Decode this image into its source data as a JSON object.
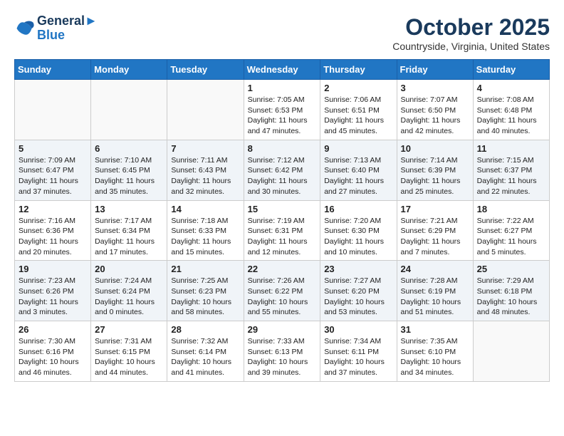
{
  "header": {
    "logo_line1": "General",
    "logo_line2": "Blue",
    "month": "October 2025",
    "location": "Countryside, Virginia, United States"
  },
  "weekdays": [
    "Sunday",
    "Monday",
    "Tuesday",
    "Wednesday",
    "Thursday",
    "Friday",
    "Saturday"
  ],
  "weeks": [
    [
      {
        "day": "",
        "info": ""
      },
      {
        "day": "",
        "info": ""
      },
      {
        "day": "",
        "info": ""
      },
      {
        "day": "1",
        "info": "Sunrise: 7:05 AM\nSunset: 6:53 PM\nDaylight: 11 hours and 47 minutes."
      },
      {
        "day": "2",
        "info": "Sunrise: 7:06 AM\nSunset: 6:51 PM\nDaylight: 11 hours and 45 minutes."
      },
      {
        "day": "3",
        "info": "Sunrise: 7:07 AM\nSunset: 6:50 PM\nDaylight: 11 hours and 42 minutes."
      },
      {
        "day": "4",
        "info": "Sunrise: 7:08 AM\nSunset: 6:48 PM\nDaylight: 11 hours and 40 minutes."
      }
    ],
    [
      {
        "day": "5",
        "info": "Sunrise: 7:09 AM\nSunset: 6:47 PM\nDaylight: 11 hours and 37 minutes."
      },
      {
        "day": "6",
        "info": "Sunrise: 7:10 AM\nSunset: 6:45 PM\nDaylight: 11 hours and 35 minutes."
      },
      {
        "day": "7",
        "info": "Sunrise: 7:11 AM\nSunset: 6:43 PM\nDaylight: 11 hours and 32 minutes."
      },
      {
        "day": "8",
        "info": "Sunrise: 7:12 AM\nSunset: 6:42 PM\nDaylight: 11 hours and 30 minutes."
      },
      {
        "day": "9",
        "info": "Sunrise: 7:13 AM\nSunset: 6:40 PM\nDaylight: 11 hours and 27 minutes."
      },
      {
        "day": "10",
        "info": "Sunrise: 7:14 AM\nSunset: 6:39 PM\nDaylight: 11 hours and 25 minutes."
      },
      {
        "day": "11",
        "info": "Sunrise: 7:15 AM\nSunset: 6:37 PM\nDaylight: 11 hours and 22 minutes."
      }
    ],
    [
      {
        "day": "12",
        "info": "Sunrise: 7:16 AM\nSunset: 6:36 PM\nDaylight: 11 hours and 20 minutes."
      },
      {
        "day": "13",
        "info": "Sunrise: 7:17 AM\nSunset: 6:34 PM\nDaylight: 11 hours and 17 minutes."
      },
      {
        "day": "14",
        "info": "Sunrise: 7:18 AM\nSunset: 6:33 PM\nDaylight: 11 hours and 15 minutes."
      },
      {
        "day": "15",
        "info": "Sunrise: 7:19 AM\nSunset: 6:31 PM\nDaylight: 11 hours and 12 minutes."
      },
      {
        "day": "16",
        "info": "Sunrise: 7:20 AM\nSunset: 6:30 PM\nDaylight: 11 hours and 10 minutes."
      },
      {
        "day": "17",
        "info": "Sunrise: 7:21 AM\nSunset: 6:29 PM\nDaylight: 11 hours and 7 minutes."
      },
      {
        "day": "18",
        "info": "Sunrise: 7:22 AM\nSunset: 6:27 PM\nDaylight: 11 hours and 5 minutes."
      }
    ],
    [
      {
        "day": "19",
        "info": "Sunrise: 7:23 AM\nSunset: 6:26 PM\nDaylight: 11 hours and 3 minutes."
      },
      {
        "day": "20",
        "info": "Sunrise: 7:24 AM\nSunset: 6:24 PM\nDaylight: 11 hours and 0 minutes."
      },
      {
        "day": "21",
        "info": "Sunrise: 7:25 AM\nSunset: 6:23 PM\nDaylight: 10 hours and 58 minutes."
      },
      {
        "day": "22",
        "info": "Sunrise: 7:26 AM\nSunset: 6:22 PM\nDaylight: 10 hours and 55 minutes."
      },
      {
        "day": "23",
        "info": "Sunrise: 7:27 AM\nSunset: 6:20 PM\nDaylight: 10 hours and 53 minutes."
      },
      {
        "day": "24",
        "info": "Sunrise: 7:28 AM\nSunset: 6:19 PM\nDaylight: 10 hours and 51 minutes."
      },
      {
        "day": "25",
        "info": "Sunrise: 7:29 AM\nSunset: 6:18 PM\nDaylight: 10 hours and 48 minutes."
      }
    ],
    [
      {
        "day": "26",
        "info": "Sunrise: 7:30 AM\nSunset: 6:16 PM\nDaylight: 10 hours and 46 minutes."
      },
      {
        "day": "27",
        "info": "Sunrise: 7:31 AM\nSunset: 6:15 PM\nDaylight: 10 hours and 44 minutes."
      },
      {
        "day": "28",
        "info": "Sunrise: 7:32 AM\nSunset: 6:14 PM\nDaylight: 10 hours and 41 minutes."
      },
      {
        "day": "29",
        "info": "Sunrise: 7:33 AM\nSunset: 6:13 PM\nDaylight: 10 hours and 39 minutes."
      },
      {
        "day": "30",
        "info": "Sunrise: 7:34 AM\nSunset: 6:11 PM\nDaylight: 10 hours and 37 minutes."
      },
      {
        "day": "31",
        "info": "Sunrise: 7:35 AM\nSunset: 6:10 PM\nDaylight: 10 hours and 34 minutes."
      },
      {
        "day": "",
        "info": ""
      }
    ]
  ]
}
